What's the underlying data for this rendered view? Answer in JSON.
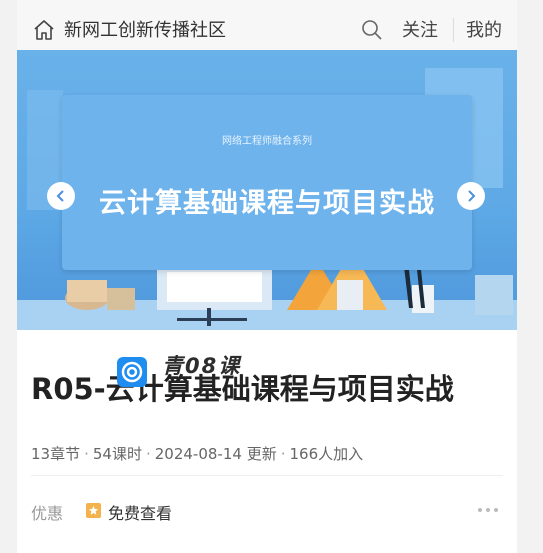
{
  "header": {
    "site_title": "新网工创新传播社区",
    "follow_label": "关注",
    "mine_label": "我的"
  },
  "banner": {
    "subtitle": "网络工程师融合系列",
    "title": "云计算基础课程与项目实战"
  },
  "course": {
    "title": "R05-云计算基础课程与项目实战",
    "watermark_text": "青08课",
    "meta": {
      "chapters": "13章节",
      "lessons": "54课时",
      "updated": "2024-08-14 更新",
      "joined": "166人加入"
    },
    "offer_label": "优惠",
    "offer_text": "免费查看"
  },
  "colors": {
    "banner_blue": "#5ea9e6",
    "card_blue": "#6eb3ec",
    "offer_badge": "#f3b24c"
  },
  "icons": [
    "home-icon",
    "search-icon",
    "arrow-left-icon",
    "arrow-right-icon",
    "star-badge-icon",
    "more-icon"
  ]
}
